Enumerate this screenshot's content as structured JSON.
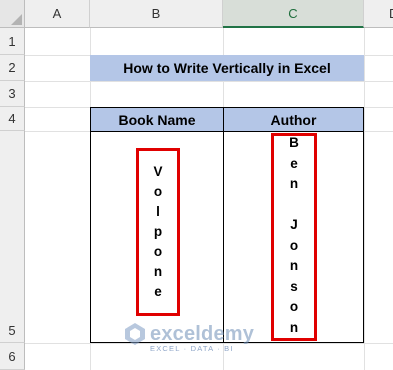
{
  "columns": [
    "A",
    "B",
    "C",
    "D"
  ],
  "rows": [
    "1",
    "2",
    "3",
    "4",
    "5",
    "6"
  ],
  "title": "How to Write Vertically in Excel",
  "table": {
    "headers": [
      "Book Name",
      "Author"
    ],
    "book_name_chars": [
      "V",
      "o",
      "l",
      "p",
      "o",
      "n",
      "e"
    ],
    "author_chars": [
      "B",
      "e",
      "n",
      "",
      "J",
      "o",
      "n",
      "s",
      "o",
      "n"
    ]
  },
  "watermark": {
    "name": "exceldemy",
    "tagline": "EXCEL · DATA · BI"
  },
  "colors": {
    "header_fill": "#b4c6e7",
    "highlight_border": "#e00000",
    "selected_column_accent": "#217346"
  }
}
